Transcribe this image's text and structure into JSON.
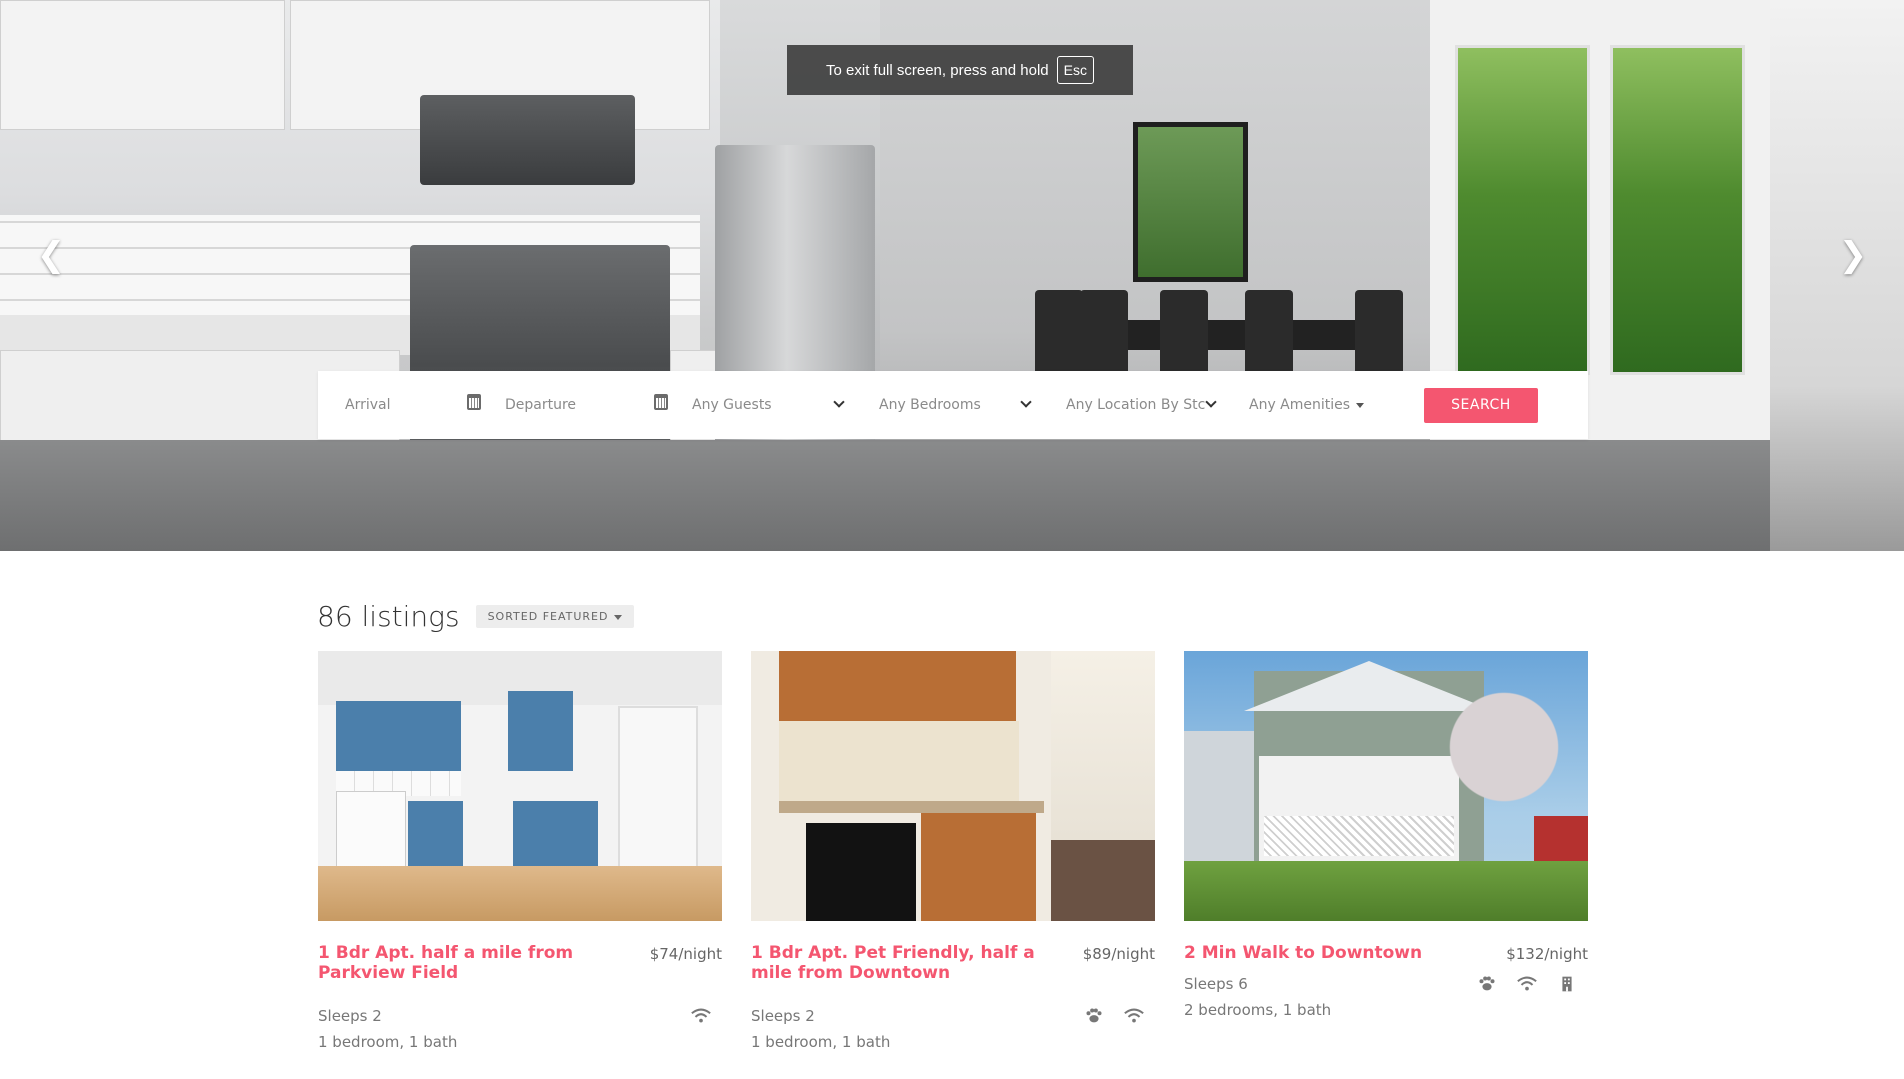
{
  "fullscreen_toast": {
    "text": "To exit full screen, press and hold",
    "key": "Esc"
  },
  "hero": {
    "prev_icon": "chevron-left-icon",
    "next_icon": "chevron-right-icon"
  },
  "search": {
    "arrival_placeholder": "Arrival",
    "departure_placeholder": "Departure",
    "guests_value": "Any Guests",
    "bedrooms_value": "Any Bedrooms",
    "location_value": "Any Location By Stc",
    "amenities_value": "Any Amenities",
    "search_label": "SEARCH"
  },
  "listings": {
    "count_label": "86 listings",
    "sort_label": "SORTED FEATURED",
    "items": [
      {
        "title": "1 Bdr Apt. half a mile from Parkview Field",
        "price": "$74/night",
        "sleeps": "Sleeps 2",
        "rooms": "1 bedroom, 1 bath",
        "amenities": [
          "wifi-icon"
        ]
      },
      {
        "title": "1 Bdr Apt. Pet Friendly, half a mile from Downtown",
        "price": "$89/night",
        "sleeps": "Sleeps 2",
        "rooms": "1 bedroom, 1 bath",
        "amenities": [
          "paw-icon",
          "wifi-icon"
        ]
      },
      {
        "title": "2 Min Walk to Downtown",
        "price": "$132/night",
        "sleeps": "Sleeps 6",
        "rooms": "2 bedrooms, 1 bath",
        "amenities": [
          "paw-icon",
          "wifi-icon",
          "building-icon"
        ]
      }
    ]
  },
  "colors": {
    "accent": "#f45670",
    "text": "#777777"
  }
}
